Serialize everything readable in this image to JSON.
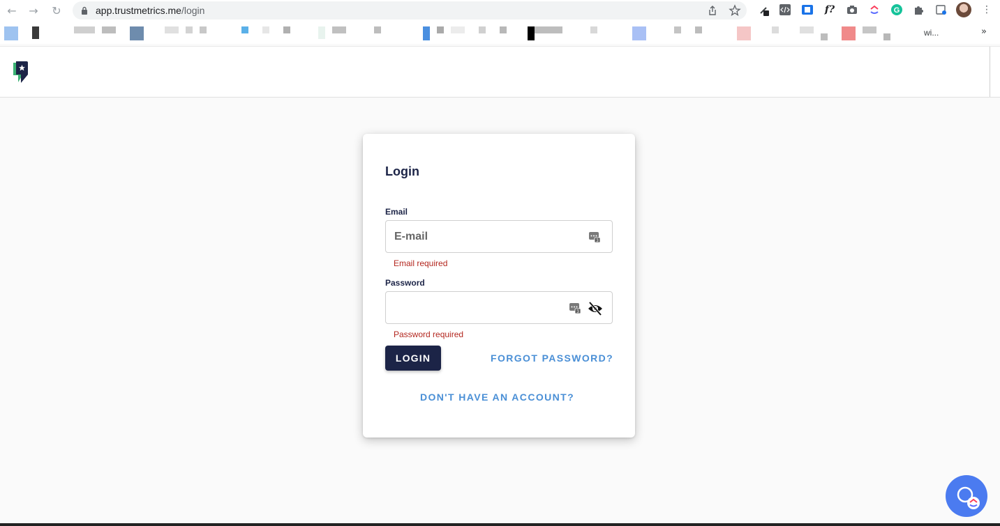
{
  "browser": {
    "url_host": "app.trustmetrics.me",
    "url_path": "/login",
    "bookmark_overflow_text": "wi...",
    "extension_f_label": "f?"
  },
  "login": {
    "title": "Login",
    "email_label": "Email",
    "email_placeholder": "E-mail",
    "email_error": "Email required",
    "password_label": "Password",
    "password_error": "Password required",
    "login_button": "LOGIN",
    "forgot_password": "FORGOT PASSWORD?",
    "no_account": "DON'T HAVE AN ACCOUNT?"
  },
  "colors": {
    "primary": "#1c2447",
    "link": "#4a8fd6",
    "error": "#b3261e",
    "fab": "#4b7bf0",
    "logo_green": "#3bb273"
  },
  "icons": {
    "lock": "lock-icon",
    "share": "share-icon",
    "star": "star-icon",
    "password_manager": "password-manager-icon",
    "eye_off": "eye-off-icon",
    "help": "chat-help-icon"
  }
}
